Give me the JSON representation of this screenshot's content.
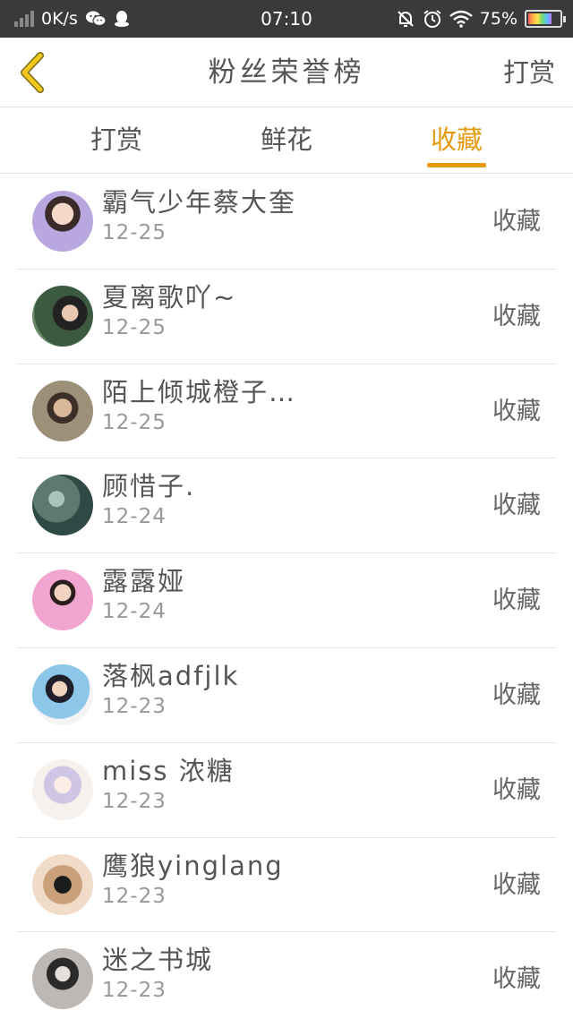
{
  "status_bar": {
    "network_speed": "0K/s",
    "time": "07:10",
    "battery": "75%",
    "battery_level": 0.75
  },
  "header": {
    "back_icon": "chevron-left-icon",
    "title": "粉丝荣誉榜",
    "action_label": "打赏"
  },
  "tabs": [
    {
      "label": "打赏",
      "active": false
    },
    {
      "label": "鲜花",
      "active": false
    },
    {
      "label": "收藏",
      "active": true
    }
  ],
  "colors": {
    "accent": "#e59a10",
    "text": "#555555",
    "subtext": "#999999",
    "divider": "#e6e6e6",
    "status_bar": "#3a3a3a"
  },
  "rows": [
    {
      "name": "霸气少年蔡大奎",
      "date": "12-25",
      "action": "收藏"
    },
    {
      "name": "夏离歌吖~",
      "date": "12-25",
      "action": "收藏"
    },
    {
      "name": "陌上倾城橙子…",
      "date": "12-25",
      "action": "收藏"
    },
    {
      "name": "顾惜子.",
      "date": "12-24",
      "action": "收藏"
    },
    {
      "name": "露露娅",
      "date": "12-24",
      "action": "收藏"
    },
    {
      "name": "落枫adfjlk",
      "date": "12-23",
      "action": "收藏"
    },
    {
      "name": "miss 浓糖",
      "date": "12-23",
      "action": "收藏"
    },
    {
      "name": "鹰狼yinglang",
      "date": "12-23",
      "action": "收藏"
    },
    {
      "name": "迷之书城",
      "date": "12-23",
      "action": "收藏"
    }
  ]
}
